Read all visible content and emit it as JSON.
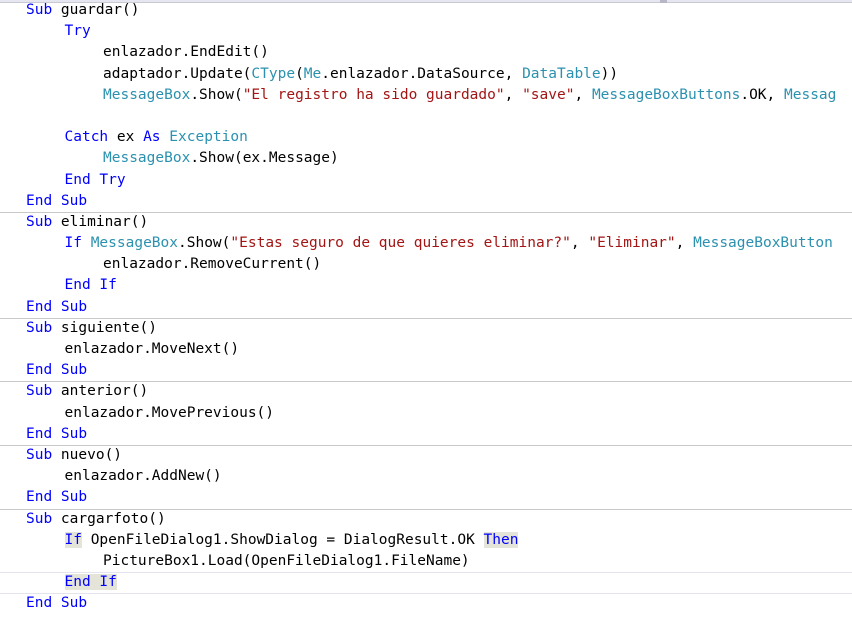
{
  "editor": {
    "language": "Visual Basic .NET",
    "colors": {
      "background": "#ffffff",
      "keyword": "#0000ff",
      "type": "#2b91af",
      "string": "#a31515",
      "plain": "#000000",
      "highlight": "#e4e4d8",
      "separator": "#c8c8c8",
      "separator_light": "#e4e4ee"
    }
  },
  "code": {
    "lines": [
      {
        "id": "line-1",
        "separator": "none",
        "indent": 0,
        "tokens": [
          {
            "t": "Sub",
            "c": "kw"
          },
          {
            "t": " guardar()",
            "c": "pln"
          }
        ]
      },
      {
        "id": "line-2",
        "separator": "none",
        "indent": 1,
        "tokens": [
          {
            "t": "Try",
            "c": "kw"
          }
        ]
      },
      {
        "id": "line-3",
        "separator": "none",
        "indent": 2,
        "tokens": [
          {
            "t": "enlazador.EndEdit()",
            "c": "pln"
          }
        ]
      },
      {
        "id": "line-4",
        "separator": "none",
        "indent": 2,
        "tokens": [
          {
            "t": "adaptador.Update(",
            "c": "pln"
          },
          {
            "t": "CType",
            "c": "typ"
          },
          {
            "t": "(",
            "c": "pln"
          },
          {
            "t": "Me",
            "c": "typ"
          },
          {
            "t": ".enlazador.DataSource, ",
            "c": "pln"
          },
          {
            "t": "DataTable",
            "c": "typ"
          },
          {
            "t": "))",
            "c": "pln"
          }
        ]
      },
      {
        "id": "line-5",
        "separator": "none",
        "indent": 2,
        "tokens": [
          {
            "t": "MessageBox",
            "c": "typ"
          },
          {
            "t": ".Show(",
            "c": "pln"
          },
          {
            "t": "\"El registro ha sido guardado\"",
            "c": "str"
          },
          {
            "t": ", ",
            "c": "pln"
          },
          {
            "t": "\"save\"",
            "c": "str"
          },
          {
            "t": ", ",
            "c": "pln"
          },
          {
            "t": "MessageBoxButtons",
            "c": "typ"
          },
          {
            "t": ".OK, ",
            "c": "pln"
          },
          {
            "t": "Messag",
            "c": "typ"
          }
        ]
      },
      {
        "id": "line-6",
        "separator": "none",
        "indent": 0,
        "tokens": []
      },
      {
        "id": "line-7",
        "separator": "none",
        "indent": 1,
        "tokens": [
          {
            "t": "Catch",
            "c": "kw"
          },
          {
            "t": " ex ",
            "c": "pln"
          },
          {
            "t": "As",
            "c": "kw"
          },
          {
            "t": " ",
            "c": "pln"
          },
          {
            "t": "Exception",
            "c": "typ"
          }
        ]
      },
      {
        "id": "line-8",
        "separator": "none",
        "indent": 2,
        "tokens": [
          {
            "t": "MessageBox",
            "c": "typ"
          },
          {
            "t": ".Show(ex.Message)",
            "c": "pln"
          }
        ]
      },
      {
        "id": "line-9",
        "separator": "none",
        "indent": 1,
        "tokens": [
          {
            "t": "End Try",
            "c": "kw"
          }
        ]
      },
      {
        "id": "line-10",
        "separator": "none",
        "indent": 0,
        "tokens": [
          {
            "t": "End Sub",
            "c": "kw"
          }
        ]
      },
      {
        "id": "line-11",
        "separator": "block",
        "indent": 0,
        "tokens": [
          {
            "t": "Sub",
            "c": "kw"
          },
          {
            "t": " eliminar()",
            "c": "pln"
          }
        ]
      },
      {
        "id": "line-12",
        "separator": "none",
        "indent": 1,
        "tokens": [
          {
            "t": "If",
            "c": "kw"
          },
          {
            "t": " ",
            "c": "pln"
          },
          {
            "t": "MessageBox",
            "c": "typ"
          },
          {
            "t": ".Show(",
            "c": "pln"
          },
          {
            "t": "\"Estas seguro de que quieres eliminar?\"",
            "c": "str"
          },
          {
            "t": ", ",
            "c": "pln"
          },
          {
            "t": "\"Eliminar\"",
            "c": "str"
          },
          {
            "t": ", ",
            "c": "pln"
          },
          {
            "t": "MessageBoxButton",
            "c": "typ"
          }
        ]
      },
      {
        "id": "line-13",
        "separator": "none",
        "indent": 2,
        "tokens": [
          {
            "t": "enlazador.RemoveCurrent()",
            "c": "pln"
          }
        ]
      },
      {
        "id": "line-14",
        "separator": "none",
        "indent": 1,
        "tokens": [
          {
            "t": "End If",
            "c": "kw"
          }
        ]
      },
      {
        "id": "line-15",
        "separator": "none",
        "indent": 0,
        "tokens": [
          {
            "t": "End Sub",
            "c": "kw"
          }
        ]
      },
      {
        "id": "line-16",
        "separator": "block",
        "indent": 0,
        "tokens": [
          {
            "t": "Sub",
            "c": "kw"
          },
          {
            "t": " siguiente()",
            "c": "pln"
          }
        ]
      },
      {
        "id": "line-17",
        "separator": "none",
        "indent": 1,
        "tokens": [
          {
            "t": "enlazador.MoveNext()",
            "c": "pln"
          }
        ]
      },
      {
        "id": "line-18",
        "separator": "none",
        "indent": 0,
        "tokens": [
          {
            "t": "End Sub",
            "c": "kw"
          }
        ]
      },
      {
        "id": "line-19",
        "separator": "block",
        "indent": 0,
        "tokens": [
          {
            "t": "Sub",
            "c": "kw"
          },
          {
            "t": " anterior()",
            "c": "pln"
          }
        ]
      },
      {
        "id": "line-20",
        "separator": "none",
        "indent": 1,
        "tokens": [
          {
            "t": "enlazador.MovePrevious()",
            "c": "pln"
          }
        ]
      },
      {
        "id": "line-21",
        "separator": "none",
        "indent": 0,
        "tokens": [
          {
            "t": "End Sub",
            "c": "kw"
          }
        ]
      },
      {
        "id": "line-22",
        "separator": "block",
        "indent": 0,
        "tokens": [
          {
            "t": "Sub",
            "c": "kw"
          },
          {
            "t": " nuevo()",
            "c": "pln"
          }
        ]
      },
      {
        "id": "line-23",
        "separator": "none",
        "indent": 1,
        "tokens": [
          {
            "t": "enlazador.AddNew()",
            "c": "pln"
          }
        ]
      },
      {
        "id": "line-24",
        "separator": "none",
        "indent": 0,
        "tokens": [
          {
            "t": "End Sub",
            "c": "kw"
          }
        ]
      },
      {
        "id": "line-25",
        "separator": "block",
        "indent": 0,
        "tokens": [
          {
            "t": "Sub",
            "c": "kw"
          },
          {
            "t": " cargarfoto()",
            "c": "pln"
          }
        ]
      },
      {
        "id": "line-26",
        "separator": "none",
        "indent": 1,
        "tokens": [
          {
            "t": "If",
            "c": "kw hl"
          },
          {
            "t": " OpenFileDialog1.ShowDialog = DialogResult.OK ",
            "c": "pln"
          },
          {
            "t": "Then",
            "c": "kw hl"
          }
        ]
      },
      {
        "id": "line-27",
        "separator": "none",
        "indent": 2,
        "tokens": [
          {
            "t": "PictureBox1.Load(OpenFileDialog1.FileName)",
            "c": "pln"
          }
        ]
      },
      {
        "id": "line-28",
        "separator": "light",
        "indent": 1,
        "tokens": [
          {
            "t": "End If",
            "c": "kw hl"
          }
        ]
      },
      {
        "id": "line-29",
        "separator": "light",
        "indent": 0,
        "tokens": [
          {
            "t": "End Sub",
            "c": "kw"
          }
        ]
      }
    ]
  }
}
